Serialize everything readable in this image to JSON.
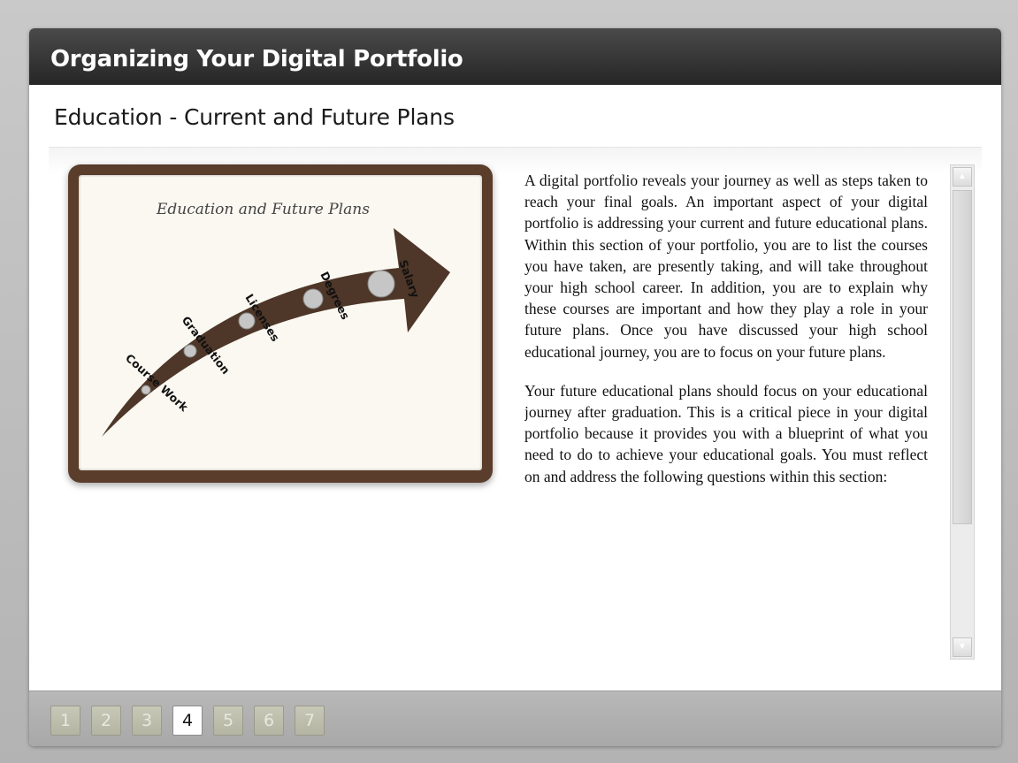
{
  "window": {
    "title": "Organizing Your Digital Portfolio"
  },
  "section": {
    "title": "Education - Current and Future Plans"
  },
  "image": {
    "title": "Education and Future Plans",
    "labels": [
      "Course Work",
      "Graduation",
      "Licenses",
      "Degrees",
      "Salary"
    ],
    "colors": {
      "frame": "#5a3d2b",
      "arrow": "#4e3628",
      "paper": "#faf8f1",
      "dot": "#c6c6c6"
    }
  },
  "body": {
    "paragraphs": [
      "A digital portfolio reveals your journey as well as steps taken to reach your final goals. An important aspect of your digital portfolio is addressing your current and future educational plans. Within this section of your portfolio, you are to list the courses you have taken, are presently taking, and will take throughout your high school career. In addition, you are to explain why these courses are important and how they play a role in your future plans. Once you have discussed your high school educational journey, you are to focus on your future plans.",
      "Your future educational plans should focus on your educational journey after graduation. This is a critical piece in your digital portfolio because it provides you with a blueprint of what you need to do to achieve your educational goals. You must reflect on and address the following questions within this section:"
    ]
  },
  "scrollbar": {
    "up_icon": "▲",
    "down_icon": "▼"
  },
  "pagination": {
    "pages": [
      "1",
      "2",
      "3",
      "4",
      "5",
      "6",
      "7"
    ],
    "current": "4"
  }
}
